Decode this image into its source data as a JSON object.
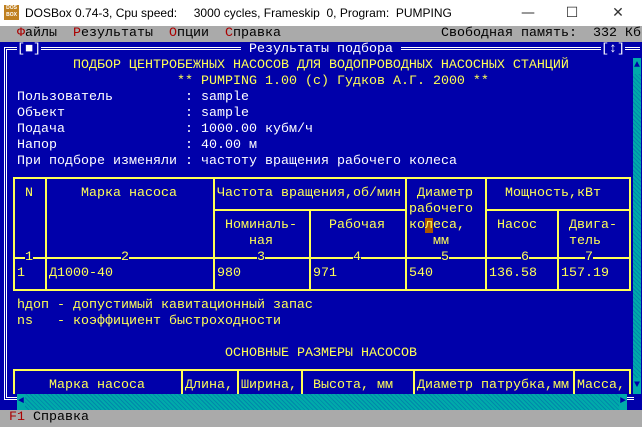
{
  "window": {
    "title": "DOSBox 0.74-3, Cpu speed:     3000 cycles, Frameskip  0, Program:  PUMPING",
    "icon_text": "DOS BOX",
    "minimize": "—",
    "maximize": "☐",
    "close": "✕"
  },
  "menu": {
    "items": [
      {
        "hot": "Ф",
        "rest": "айлы"
      },
      {
        "hot": "Р",
        "rest": "езультаты"
      },
      {
        "hot": "О",
        "rest": "пции"
      },
      {
        "hot": "С",
        "rest": "правка"
      }
    ],
    "memory_label": "Свободная память:",
    "memory_value": "332 Кб"
  },
  "frame": {
    "title": " Результаты подбора ",
    "close_btn": "[■]",
    "zoom_btn": "[↕]"
  },
  "header": {
    "line1": "ПОДБОР ЦЕНТРОБЕЖНЫХ НАСОСОВ ДЛЯ ВОДОПРОВОДНЫХ НАСОСНЫХ СТАНЦИЙ",
    "line2": "** PUMPING 1.00 (c) Гудков А.Г. 2000 **"
  },
  "info": [
    {
      "label": "Пользователь",
      "value": ": sample"
    },
    {
      "label": "Объект",
      "value": ": sample"
    },
    {
      "label": "Подача",
      "value": ": 1000.00 кубм/ч"
    },
    {
      "label": "Напор",
      "value": ": 40.00 м"
    },
    {
      "label": "При подборе изменяли",
      "value": ": частоту вращения рабочего колеса"
    }
  ],
  "table1": {
    "h_n": "N",
    "h_mark": "Марка насоса",
    "h_freq": "Частота вращения,об/мин",
    "h_diam1": "Диаметр",
    "h_diam2": "рабочего",
    "h_diam3a": "ко",
    "h_diam3b": "л",
    "h_diam3c": "еса,",
    "h_diam4": "мм",
    "h_power": "Мощность,кВт",
    "h_nom1": "Номиналь-",
    "h_nom2": "ная",
    "h_work": "Рабочая",
    "h_pump": "Насос",
    "h_motor1": "Двига-",
    "h_motor2": "тель",
    "col_numbers": [
      "1",
      "2",
      "3",
      "4",
      "5",
      "6",
      "7"
    ],
    "rows": [
      [
        "1",
        "Д1000-40",
        "980",
        "971",
        "540",
        "136.58",
        "157.19"
      ]
    ]
  },
  "notes": [
    "hдоп - допустимый кавитационный запас",
    "ns   - коэффициент быстроходности"
  ],
  "section2": {
    "title": "ОСНОВНЫЕ РАЗМЕРЫ НАСОСОВ",
    "headers": [
      "Марка насоса",
      "Длина,",
      "Ширина,",
      "Высота, мм",
      "Диаметр патрубка,мм",
      "Масса,"
    ]
  },
  "statusbar": {
    "key": "F1",
    "label": " Справка"
  },
  "scroll": {
    "up": "▲",
    "down": "▼",
    "left": "◄",
    "right": "►"
  }
}
